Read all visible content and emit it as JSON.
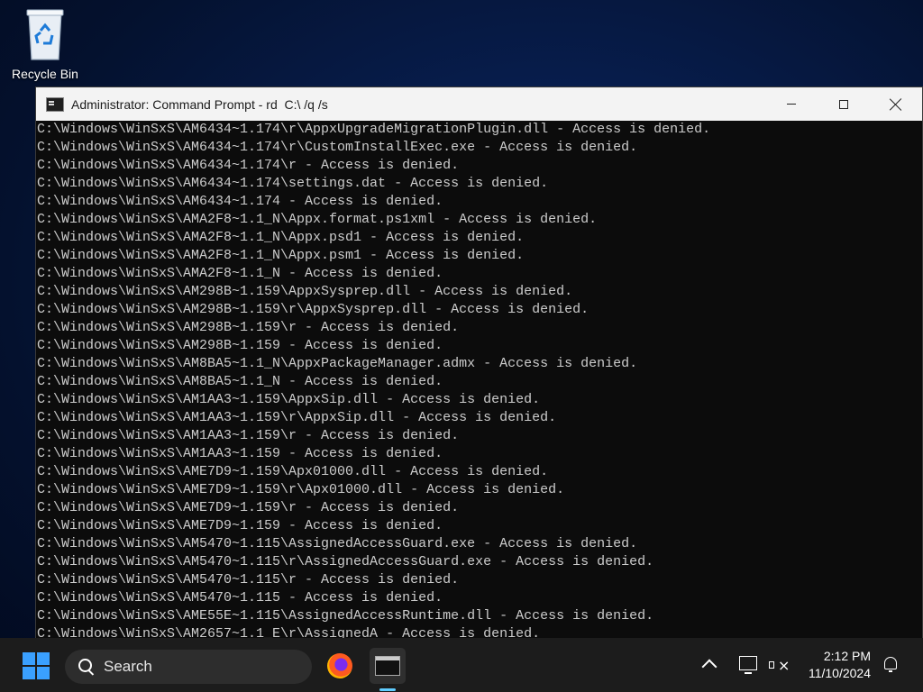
{
  "desktop": {
    "icons": [
      {
        "label": "Recycle Bin",
        "icon": "recycle-bin-icon"
      }
    ]
  },
  "window": {
    "title": "Administrator: Command Prompt - rd  C:\\ /q /s",
    "controls": {
      "minimize": "minimize",
      "maximize": "maximize",
      "close": "close"
    },
    "console_lines": [
      "C:\\Windows\\WinSxS\\AM6434~1.174\\r\\AppxUpgradeMigrationPlugin.dll - Access is denied.",
      "C:\\Windows\\WinSxS\\AM6434~1.174\\r\\CustomInstallExec.exe - Access is denied.",
      "C:\\Windows\\WinSxS\\AM6434~1.174\\r - Access is denied.",
      "C:\\Windows\\WinSxS\\AM6434~1.174\\settings.dat - Access is denied.",
      "C:\\Windows\\WinSxS\\AM6434~1.174 - Access is denied.",
      "C:\\Windows\\WinSxS\\AMA2F8~1.1_N\\Appx.format.ps1xml - Access is denied.",
      "C:\\Windows\\WinSxS\\AMA2F8~1.1_N\\Appx.psd1 - Access is denied.",
      "C:\\Windows\\WinSxS\\AMA2F8~1.1_N\\Appx.psm1 - Access is denied.",
      "C:\\Windows\\WinSxS\\AMA2F8~1.1_N - Access is denied.",
      "C:\\Windows\\WinSxS\\AM298B~1.159\\AppxSysprep.dll - Access is denied.",
      "C:\\Windows\\WinSxS\\AM298B~1.159\\r\\AppxSysprep.dll - Access is denied.",
      "C:\\Windows\\WinSxS\\AM298B~1.159\\r - Access is denied.",
      "C:\\Windows\\WinSxS\\AM298B~1.159 - Access is denied.",
      "C:\\Windows\\WinSxS\\AM8BA5~1.1_N\\AppxPackageManager.admx - Access is denied.",
      "C:\\Windows\\WinSxS\\AM8BA5~1.1_N - Access is denied.",
      "C:\\Windows\\WinSxS\\AM1AA3~1.159\\AppxSip.dll - Access is denied.",
      "C:\\Windows\\WinSxS\\AM1AA3~1.159\\r\\AppxSip.dll - Access is denied.",
      "C:\\Windows\\WinSxS\\AM1AA3~1.159\\r - Access is denied.",
      "C:\\Windows\\WinSxS\\AM1AA3~1.159 - Access is denied.",
      "C:\\Windows\\WinSxS\\AME7D9~1.159\\Apx01000.dll - Access is denied.",
      "C:\\Windows\\WinSxS\\AME7D9~1.159\\r\\Apx01000.dll - Access is denied.",
      "C:\\Windows\\WinSxS\\AME7D9~1.159\\r - Access is denied.",
      "C:\\Windows\\WinSxS\\AME7D9~1.159 - Access is denied.",
      "C:\\Windows\\WinSxS\\AM5470~1.115\\AssignedAccessGuard.exe - Access is denied.",
      "C:\\Windows\\WinSxS\\AM5470~1.115\\r\\AssignedAccessGuard.exe - Access is denied.",
      "C:\\Windows\\WinSxS\\AM5470~1.115\\r - Access is denied.",
      "C:\\Windows\\WinSxS\\AM5470~1.115 - Access is denied.",
      "C:\\Windows\\WinSxS\\AME55E~1.115\\AssignedAccessRuntime.dll - Access is denied.",
      "C:\\Windows\\WinSxS\\AM2657~1.1_E\\r\\AssignedA - Access is denied."
    ]
  },
  "taskbar": {
    "search_placeholder": "Search",
    "apps": [
      {
        "name": "Firefox",
        "icon": "firefox-icon"
      },
      {
        "name": "Command Prompt",
        "icon": "command-prompt-icon",
        "active": true
      }
    ],
    "tray": {
      "time": "2:12 PM",
      "date": "11/10/2024"
    }
  },
  "colors": {
    "console_bg": "#0c0c0c",
    "console_fg": "#cccccc",
    "taskbar_bg": "#1c1c1c",
    "accent": "#60cdff"
  }
}
